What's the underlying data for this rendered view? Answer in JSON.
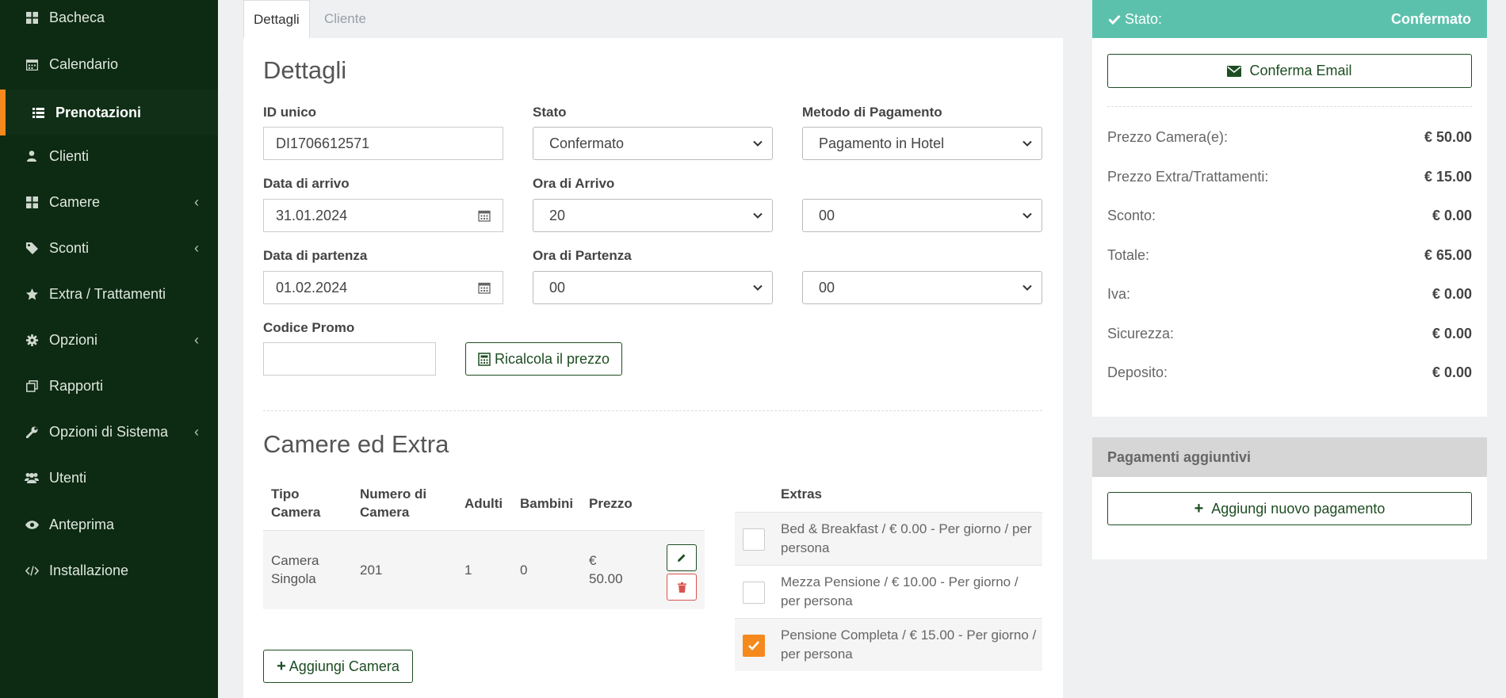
{
  "sidebar": {
    "items": [
      {
        "label": "Bacheca",
        "icon": "dashboard-icon",
        "has_submenu": false
      },
      {
        "label": "Calendario",
        "icon": "calendar-icon",
        "has_submenu": false
      },
      {
        "label": "Prenotazioni",
        "icon": "list-icon",
        "has_submenu": false,
        "active": true
      },
      {
        "label": "Clienti",
        "icon": "user-icon",
        "has_submenu": false
      },
      {
        "label": "Camere",
        "icon": "grid-icon",
        "has_submenu": true
      },
      {
        "label": "Sconti",
        "icon": "tag-icon",
        "has_submenu": true
      },
      {
        "label": "Extra / Trattamenti",
        "icon": "star-icon",
        "has_submenu": false
      },
      {
        "label": "Opzioni",
        "icon": "gear-icon",
        "has_submenu": true
      },
      {
        "label": "Rapporti",
        "icon": "copy-icon",
        "has_submenu": false
      },
      {
        "label": "Opzioni di Sistema",
        "icon": "wrench-icon",
        "has_submenu": true
      },
      {
        "label": "Utenti",
        "icon": "users-icon",
        "has_submenu": false
      },
      {
        "label": "Anteprima",
        "icon": "eye-icon",
        "has_submenu": false
      },
      {
        "label": "Installazione",
        "icon": "code-icon",
        "has_submenu": false
      }
    ]
  },
  "tabs": [
    {
      "label": "Dettagli",
      "active": true
    },
    {
      "label": "Cliente",
      "active": false
    }
  ],
  "details": {
    "title": "Dettagli",
    "id_label": "ID unico",
    "id_value": "DI1706612571",
    "stato_label": "Stato",
    "stato_value": "Confermato",
    "payment_label": "Metodo di Pagamento",
    "payment_value": "Pagamento in Hotel",
    "arrival_date_label": "Data di arrivo",
    "arrival_date_value": "31.01.2024",
    "arrival_time_label": "Ora di Arrivo",
    "arrival_hour": "20",
    "arrival_minute": "00",
    "departure_date_label": "Data di partenza",
    "departure_date_value": "01.02.2024",
    "departure_time_label": "Ora di Partenza",
    "departure_hour": "00",
    "departure_minute": "00",
    "promo_label": "Codice Promo",
    "promo_value": "",
    "recalc_button": "Ricalcola il prezzo"
  },
  "rooms": {
    "title": "Camere ed Extra",
    "headers": {
      "type": "Tipo Camera",
      "number": "Numero di Camera",
      "adults": "Adulti",
      "children": "Bambini",
      "price": "Prezzo"
    },
    "rows": [
      {
        "type": "Camera Singola",
        "number": "201",
        "adults": "1",
        "children": "0",
        "price": "€ 50.00"
      }
    ],
    "add_button": "Aggiungi Camera"
  },
  "extras": {
    "header": "Extras",
    "items": [
      {
        "label": "Bed & Breakfast / € 0.00 - Per giorno / per persona",
        "checked": false
      },
      {
        "label": "Mezza Pensione / € 10.00 - Per giorno / per persona",
        "checked": false
      },
      {
        "label": "Pensione Completa / € 15.00 - Per giorno / per persona",
        "checked": true
      }
    ]
  },
  "status_panel": {
    "label": "Stato:",
    "value": "Confermato",
    "confirm_email_button": "Conferma Email",
    "prices": [
      {
        "label": "Prezzo Camera(e):",
        "value": "€ 50.00"
      },
      {
        "label": "Prezzo Extra/Trattamenti:",
        "value": "€ 15.00"
      },
      {
        "label": "Sconto:",
        "value": "€ 0.00"
      },
      {
        "label": "Totale:",
        "value": "€ 65.00"
      },
      {
        "label": "Iva:",
        "value": "€ 0.00"
      },
      {
        "label": "Sicurezza:",
        "value": "€ 0.00"
      },
      {
        "label": "Deposito:",
        "value": "€ 0.00"
      }
    ]
  },
  "payments": {
    "header": "Pagamenti aggiuntivi",
    "add_button": "Aggiungi nuovo pagamento"
  },
  "colors": {
    "sidebar_bg": "#0d2a12",
    "active_accent": "#f5891d",
    "brand_green": "#1d4d22",
    "status_teal": "#5cc1ac"
  }
}
